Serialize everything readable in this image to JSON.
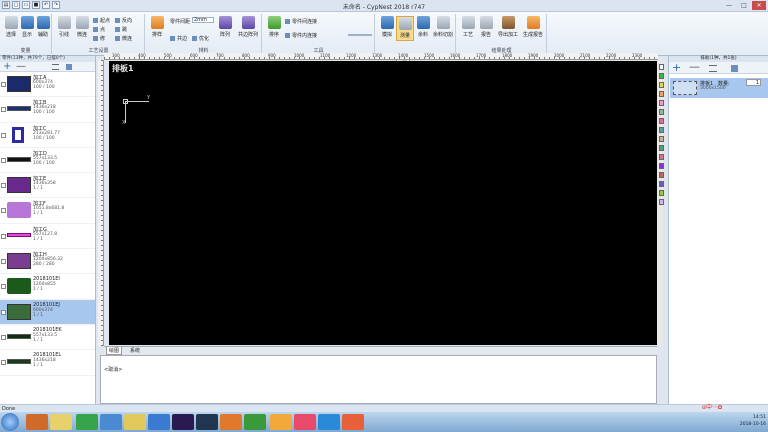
{
  "window": {
    "title": "未命名 - CypNest 2018 r747",
    "close": "✕",
    "max": "□",
    "min": "—"
  },
  "ribbon": {
    "groups": [
      "变量",
      "工艺设置",
      "排料",
      "工具",
      "结果处理"
    ],
    "buttons": {
      "select": "选择",
      "display": "显示",
      "assist": "辅助",
      "leadline": "引线",
      "micro": "微连",
      "start_point": "起点",
      "cut_point": "点",
      "lead_sm": "修",
      "reverse": "反向",
      "entry": "微连",
      "jump": "跳",
      "nest_start": "排样",
      "part_spacing_label": "零件间距",
      "part_spacing_val": "2mm",
      "edge": "边距",
      "common": "共边",
      "optimize": "优化",
      "array": "阵列",
      "common_array": "共边阵列",
      "order": "排序",
      "part_to_end": "零件间连接",
      "parts_limit": "零件内连接",
      "simulate": "模拟",
      "measure": "测量",
      "remnant": "余料",
      "remnant_cut": "余料切割",
      "process": "工艺",
      "report": "报告",
      "export_process": "导出加工",
      "generate": "生成报告"
    },
    "tooltip": "测量"
  },
  "left_panel": {
    "header": "零件(13种，共79个，已摆0个)",
    "parts": [
      {
        "name": "加工A",
        "dim": "600x374",
        "qty": "100 / 100",
        "color": "#1a2a6b",
        "shape": "rect-notch"
      },
      {
        "name": "加工B",
        "dim": "1436x218",
        "qty": "100 / 100",
        "color": "#1d2f73",
        "shape": "bar"
      },
      {
        "name": "加工C",
        "dim": "213x281.77",
        "qty": "100 / 100",
        "color": "#2c2ba0",
        "shape": "frame"
      },
      {
        "name": "加工D",
        "dim": "557x133.5",
        "qty": "100 / 100",
        "color": "#121212",
        "shape": "bar-dark"
      },
      {
        "name": "加工E",
        "dim": "1436x358",
        "qty": "1 / 1",
        "color": "#6a2a8d",
        "shape": "rect-notch"
      },
      {
        "name": "加工F",
        "dim": "1051.8x681.8",
        "qty": "1 / 1",
        "color": "#b877d8",
        "shape": "rounded"
      },
      {
        "name": "加工G",
        "dim": "557x127.8",
        "qty": "1 / 1",
        "color": "#e04cd7",
        "shape": "bar-thin"
      },
      {
        "name": "加工H",
        "dim": "1200x856.32",
        "qty": "280 / 280",
        "color": "#7b3d8f",
        "shape": "rect-notch"
      },
      {
        "name": "2018101EI",
        "dim": "1200x855",
        "qty": "1 / 1",
        "color": "#1c5a1c",
        "shape": "rounded"
      },
      {
        "name": "2018101EJ",
        "dim": "600x374",
        "qty": "1 / 1",
        "color": "#3a6c3a",
        "shape": "rect-notch"
      },
      {
        "name": "2018101EK",
        "dim": "557x133.5",
        "qty": "1 / 1",
        "color": "#102e10",
        "shape": "bar-dark"
      },
      {
        "name": "2018101EL",
        "dim": "1436x218",
        "qty": "1 / 1",
        "color": "#1b3a1b",
        "shape": "bar"
      }
    ]
  },
  "canvas": {
    "sheet_label": "排板1",
    "axis_x": "Y",
    "axis_y": "X",
    "ruler_labels": [
      "300",
      "400",
      "500",
      "600",
      "700",
      "800",
      "900",
      "1000",
      "1100",
      "1200",
      "1300",
      "1400",
      "1500",
      "1600",
      "1700",
      "1800",
      "1900",
      "2000",
      "2100",
      "2200",
      "2300"
    ]
  },
  "tabs": [
    "绘图",
    "系统"
  ],
  "command_line": "<取消>",
  "right_panel": {
    "header": "排板(1种，共1张)",
    "sheet": {
      "name": "排板1",
      "dim": "3000x1500",
      "qty_label": "数量:",
      "qty": "1"
    }
  },
  "palette": [
    "#ffffff",
    "#3bbb3b",
    "#e6d84a",
    "#f4a460",
    "#f49ac0",
    "#8fbc8f",
    "#e56aa0",
    "#5f9ea0",
    "#d2b48c",
    "#4aa37c",
    "#db7093",
    "#8a2be2",
    "#c86464",
    "#6a5acd",
    "#9acd32",
    "#d2b4f0"
  ],
  "status": "Done",
  "taskbar": {
    "time": "14:51",
    "date": "2018-10-16"
  }
}
